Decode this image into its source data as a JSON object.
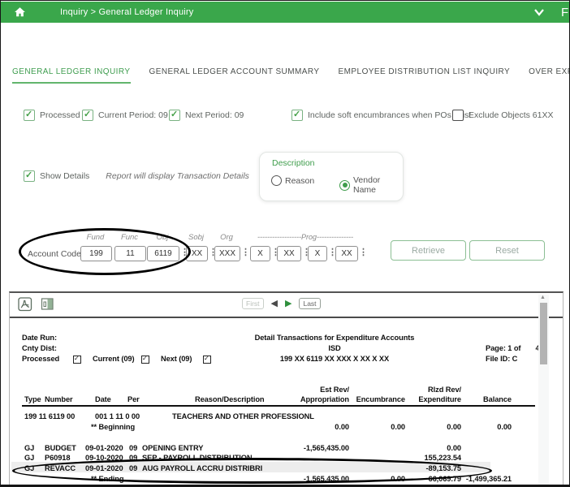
{
  "header": {
    "breadcrumb": "Inquiry > General Ledger Inquiry",
    "partial_text": "F"
  },
  "tabs": [
    {
      "label": "GENERAL LEDGER INQUIRY",
      "active": true
    },
    {
      "label": "GENERAL LEDGER ACCOUNT SUMMARY",
      "active": false
    },
    {
      "label": "EMPLOYEE DISTRIBUTION LIST INQUIRY",
      "active": false
    },
    {
      "label": "OVER EXPENDED ACCOUNT SUMMARY",
      "active": false
    }
  ],
  "filters": [
    {
      "label": "Processed",
      "checked": true
    },
    {
      "label": "Current Period: 09",
      "checked": true
    },
    {
      "label": "Next Period: 09",
      "checked": true
    },
    {
      "label": "Include soft encumbrances when POs exist",
      "checked": true
    },
    {
      "label": "Exclude Objects 61XX",
      "checked": false
    }
  ],
  "details": {
    "label": "Show Details",
    "checked": true,
    "hint": "Report will display Transaction Details"
  },
  "description": {
    "title": "Description",
    "options": [
      {
        "label": "Reason",
        "selected": false
      },
      {
        "label": "Vendor Name",
        "selected": true
      }
    ]
  },
  "account_code": {
    "label": "Account Code:",
    "prog_ruler": "------------------Prog---------------",
    "fields": [
      {
        "name": "Fund",
        "value": "199"
      },
      {
        "name": "Func",
        "value": "11"
      },
      {
        "name": "Obj",
        "value": "6119"
      },
      {
        "name": "Sobj",
        "value": "XX"
      },
      {
        "name": "Org",
        "value": "XXX"
      },
      {
        "name": "",
        "value": "X"
      },
      {
        "name": "",
        "value": "XX"
      },
      {
        "name": "",
        "value": "X"
      },
      {
        "name": "",
        "value": "XX"
      }
    ]
  },
  "actions": {
    "retrieve": "Retrieve",
    "reset": "Reset"
  },
  "report": {
    "pagination": {
      "first": "First",
      "last": "Last"
    },
    "header": {
      "date_run": "Date Run:",
      "cnty_dist": "Cnty Dist:",
      "processed": "Processed",
      "current": "Current (09)",
      "next": "Next (09)",
      "title": "Detail Transactions for Expenditure Accounts",
      "org": "ISD",
      "mask": "199  XX  6119  XX  XXX  X  XX  X  XX",
      "page_label": "Page: 1 of",
      "page_total": "4",
      "file_id": "File ID: C"
    },
    "columns": {
      "type": "Type",
      "number": "Number",
      "date": "Date",
      "per": "Per",
      "reason": "Reason/Description",
      "appro1": "Est Rev/",
      "appro2": "Appropriation",
      "encum": "Encumbrance",
      "exp1": "Rlzd Rev/",
      "exp2": "Expenditure",
      "balance": "Balance"
    },
    "rows": [
      {
        "kind": "account",
        "seg1": "199  11  6119  00",
        "seg2": "001  1  11  0  00",
        "desc": "TEACHERS AND OTHER PROFESSIONL"
      },
      {
        "kind": "summary",
        "label": "** Beginning",
        "appropriation": "0.00",
        "encumbrance": "0.00",
        "expenditure": "0.00",
        "balance": "0.00"
      },
      {
        "kind": "txn",
        "type": "GJ",
        "number": "BUDGET",
        "date": "09-01-2020",
        "per": "09",
        "reason": "OPENING ENTRY",
        "appropriation": "-1,565,435.00",
        "encumbrance": "",
        "expenditure": "0.00",
        "balance": ""
      },
      {
        "kind": "txn",
        "type": "GJ",
        "number": "P60918",
        "date": "09-10-2020",
        "per": "09",
        "reason": "SEP - PAYROLL DISTRIBUTION",
        "appropriation": "",
        "encumbrance": "",
        "expenditure": "155,223.54",
        "balance": ""
      },
      {
        "kind": "txn",
        "type": "GJ",
        "number": "REVACC",
        "date": "09-01-2020",
        "per": "09",
        "reason": "AUG PAYROLL ACCRU DISTRIBRI",
        "appropriation": "",
        "encumbrance": "",
        "expenditure": "-89,153.75",
        "balance": "",
        "highlighted": true
      },
      {
        "kind": "summary",
        "label": "** Ending",
        "appropriation": "-1,565,435.00",
        "encumbrance": "0.00",
        "expenditure": "66,069.79",
        "balance": "-1,499,365.21"
      }
    ]
  }
}
